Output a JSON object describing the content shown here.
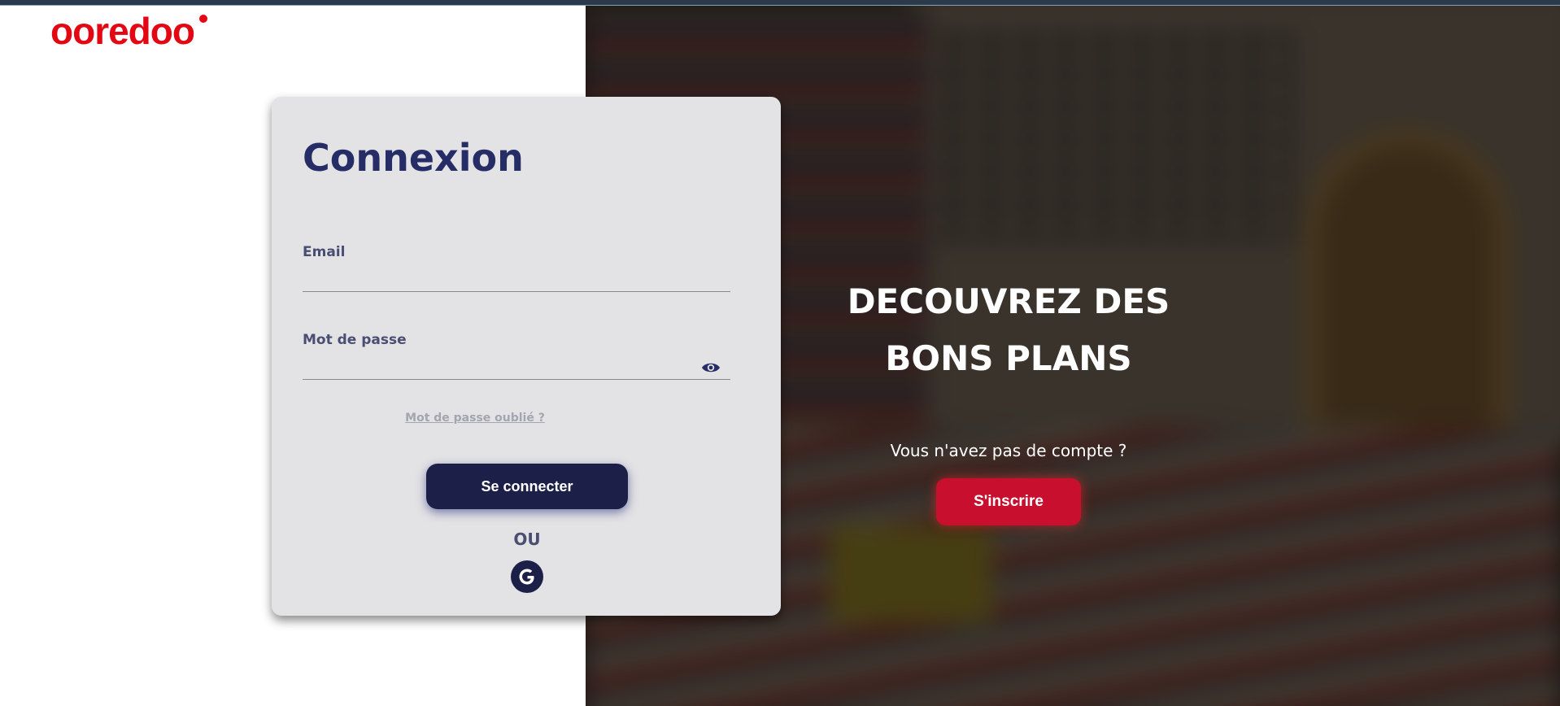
{
  "brand": {
    "name": "ooredoo",
    "logo_color": "#e30613"
  },
  "login": {
    "title": "Connexion",
    "email_label": "Email",
    "email_value": "",
    "password_label": "Mot de passe",
    "password_value": "",
    "show_password_icon": "eye-icon",
    "forgot_password": "Mot de passe oublié ?",
    "submit_label": "Se connecter",
    "or_text": "OU",
    "google_icon": "google-icon"
  },
  "hero": {
    "title_line1": "DECOUVREZ DES",
    "title_line2": "BONS PLANS",
    "subtitle": "Vous n'avez pas de compte ?",
    "signup_label": "S'inscrire"
  },
  "colors": {
    "primary_navy": "#1c2048",
    "title_navy": "#262d66",
    "accent_red": "#c8102e",
    "card_bg": "#e3e3e5"
  }
}
